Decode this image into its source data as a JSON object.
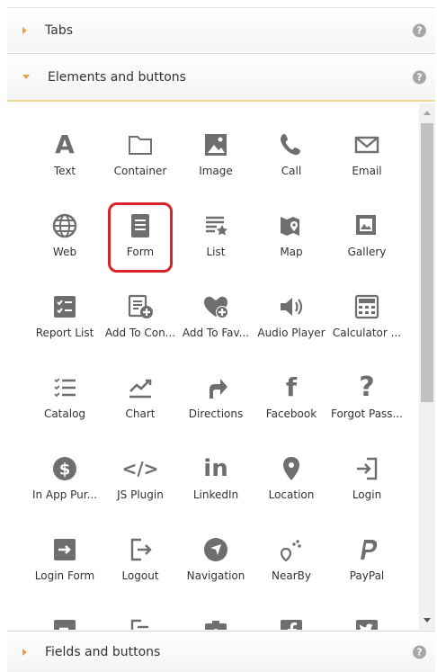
{
  "sections": {
    "tabs": "Tabs",
    "elements": "Elements and buttons",
    "fields": "Fields and buttons",
    "help": "?"
  },
  "icon_color": "#6e6e6e",
  "accent_color": "#e8a040",
  "selected_outline_color": "#d6232a",
  "elements": [
    {
      "label": "Text",
      "icon": "text-icon",
      "glyph": "A"
    },
    {
      "label": "Container",
      "icon": "container-icon"
    },
    {
      "label": "Image",
      "icon": "image-icon"
    },
    {
      "label": "Call",
      "icon": "call-icon"
    },
    {
      "label": "Email",
      "icon": "email-icon"
    },
    {
      "label": "Web",
      "icon": "web-icon"
    },
    {
      "label": "Form",
      "icon": "form-icon",
      "selected": true
    },
    {
      "label": "List",
      "icon": "list-icon"
    },
    {
      "label": "Map",
      "icon": "map-icon"
    },
    {
      "label": "Gallery",
      "icon": "gallery-icon"
    },
    {
      "label": "Report List",
      "icon": "report-list-icon"
    },
    {
      "label": "Add To Con...",
      "icon": "add-to-contacts-icon"
    },
    {
      "label": "Add To Fav...",
      "icon": "add-to-favorites-icon"
    },
    {
      "label": "Audio Player",
      "icon": "audio-player-icon"
    },
    {
      "label": "Calculator ...",
      "icon": "calculator-icon"
    },
    {
      "label": "Catalog",
      "icon": "catalog-icon"
    },
    {
      "label": "Chart",
      "icon": "chart-icon"
    },
    {
      "label": "Directions",
      "icon": "directions-icon"
    },
    {
      "label": "Facebook",
      "icon": "facebook-icon",
      "glyph": "f"
    },
    {
      "label": "Forgot Pass...",
      "icon": "forgot-password-icon",
      "glyph": "?"
    },
    {
      "label": "In App Pur...",
      "icon": "in-app-purchase-icon"
    },
    {
      "label": "JS Plugin",
      "icon": "js-plugin-icon",
      "glyph": "</>"
    },
    {
      "label": "LinkedIn",
      "icon": "linkedin-icon",
      "glyph": "in"
    },
    {
      "label": "Location",
      "icon": "location-icon"
    },
    {
      "label": "Login",
      "icon": "login-icon"
    },
    {
      "label": "Login Form",
      "icon": "login-form-icon"
    },
    {
      "label": "Logout",
      "icon": "logout-icon"
    },
    {
      "label": "Navigation",
      "icon": "navigation-icon"
    },
    {
      "label": "NearBy",
      "icon": "nearby-icon"
    },
    {
      "label": "PayPal",
      "icon": "paypal-icon"
    },
    {
      "label": "",
      "icon": "partial-login-form-icon"
    },
    {
      "label": "",
      "icon": "partial-logout-icon"
    },
    {
      "label": "",
      "icon": "partial-camera-icon"
    },
    {
      "label": "",
      "icon": "partial-facebook-icon"
    },
    {
      "label": "",
      "icon": "partial-twitter-icon"
    }
  ]
}
